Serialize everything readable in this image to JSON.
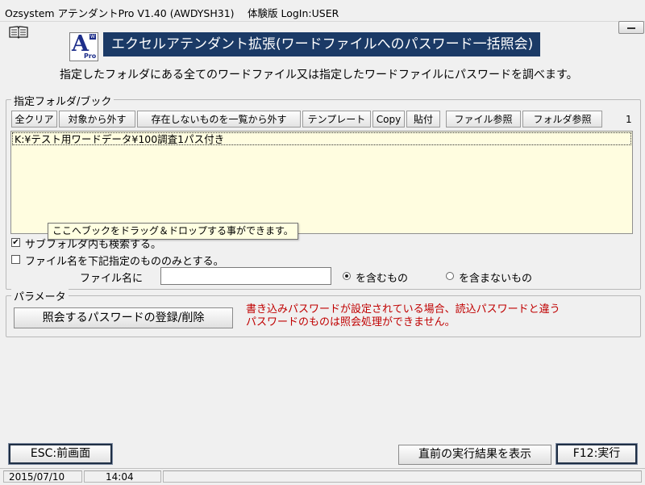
{
  "window": {
    "title": "Ozsystem アテンダントPro V1.40 (AWDYSH31)　 体験版 LogIn:USER"
  },
  "logo": {
    "letter": "A",
    "sub": "Pro",
    "sup": "W"
  },
  "banner": {
    "title": "エクセルアテンダント拡張(ワードファイルへのパスワード一括照会)"
  },
  "description": "指定したフォルダにある全てのワードファイル又は指定したワードファイルにパスワードを調べます。",
  "folder_group": {
    "legend": "指定フォルダ/ブック",
    "toolbar": {
      "clear_all": "全クリア",
      "remove_target": "対象から外す",
      "remove_missing": "存在しないものを一覧から外す",
      "template": "テンプレート",
      "copy": "Copy",
      "paste": "貼付",
      "file_browse": "ファイル参照",
      "folder_browse": "フォルダ参照"
    },
    "count": "1",
    "list_items": [
      "K:¥テスト用ワードデータ¥100調査1パス付き"
    ],
    "tooltip": "ここへブックをドラッグ＆ドロップする事ができます。",
    "subfolder_checkbox": {
      "label": "サブフォルダ内も検索する。",
      "checked": true
    },
    "filename_filter_checkbox": {
      "label": "ファイル名を下記指定のもののみとする。",
      "checked": false
    },
    "filename_label": "ファイル名に",
    "filename_value": "",
    "radio_include": {
      "label": "を含むもの",
      "selected": true
    },
    "radio_exclude": {
      "label": "を含まないもの",
      "selected": false
    }
  },
  "params_group": {
    "legend": "パラメータ",
    "register_button": "照会するパスワードの登録/削除",
    "warning_line1": "書き込みパスワードが設定されている場合、読込パスワードと違う",
    "warning_line2": "パスワードのものは照会処理ができません。"
  },
  "footer": {
    "esc_button": "ESC:前画面",
    "show_result_button": "直前の実行結果を表示",
    "run_button": "F12:実行"
  },
  "statusbar": {
    "date": "2015/07/10",
    "time": "14:04"
  },
  "colors": {
    "banner_bg": "#1b3a66",
    "list_bg": "#fffde0",
    "warning": "#c00000",
    "logo": "#1d2e8a"
  }
}
